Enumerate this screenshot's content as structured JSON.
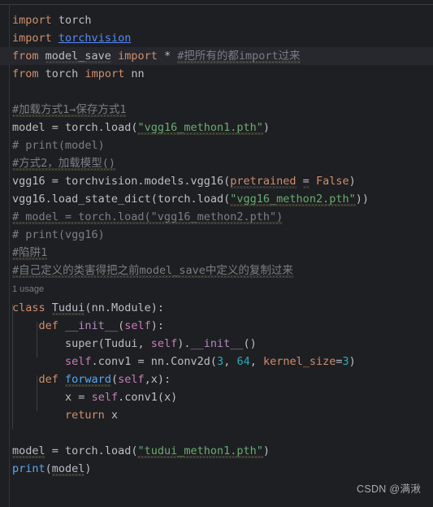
{
  "editor": {
    "theme": "darcula-dark",
    "background": "#1e1f22",
    "highlight_line_background": "#26282e",
    "default_text_color": "#bcbec4",
    "colors": {
      "keyword": "#cf8e6d",
      "string": "#6aab73",
      "number": "#2aacb8",
      "comment": "#7a7e85",
      "self_keyword": "#c77dbb",
      "function_decl": "#56a8f5",
      "dunder": "#b389c5",
      "hyperlink": "#548af7",
      "inlay_hint": "#777b82"
    },
    "inlay_hints": [
      {
        "text": "1 usage",
        "above_line": 20
      }
    ],
    "lines": [
      {
        "n": 1,
        "text": "import torch"
      },
      {
        "n": 2,
        "text": "import torchvision"
      },
      {
        "n": 3,
        "text": "from model_save import * #把所有的都import过来",
        "highlighted": true
      },
      {
        "n": 4,
        "text": "from torch import nn"
      },
      {
        "n": 5,
        "text": ""
      },
      {
        "n": 6,
        "text": "#加载方式1→保存方式1"
      },
      {
        "n": 7,
        "text": "model = torch.load(\"vgg16_methon1.pth\")"
      },
      {
        "n": 8,
        "text": "# print(model)"
      },
      {
        "n": 9,
        "text": "#方式2，加载模型()"
      },
      {
        "n": 10,
        "text": "vgg16 = torchvision.models.vgg16(pretrained = False)"
      },
      {
        "n": 11,
        "text": "vgg16.load_state_dict(torch.load(\"vgg16_methon2.pth\"))"
      },
      {
        "n": 12,
        "text": "# model = torch.load(\"vgg16_methon2.pth\")"
      },
      {
        "n": 13,
        "text": "# print(vgg16)"
      },
      {
        "n": 14,
        "text": "#陷阱1"
      },
      {
        "n": 15,
        "text": "#自己定义的类害得把之前model_save中定义的复制过来"
      },
      {
        "n": 16,
        "text": "class Tudui(nn.Module):"
      },
      {
        "n": 17,
        "text": "    def __init__(self):"
      },
      {
        "n": 18,
        "text": "        super(Tudui, self).__init__()"
      },
      {
        "n": 19,
        "text": "        self.conv1 = nn.Conv2d(3, 64, kernel_size=3)"
      },
      {
        "n": 20,
        "text": "    def forward(self,x):"
      },
      {
        "n": 21,
        "text": "        x = self.conv1(x)"
      },
      {
        "n": 22,
        "text": "        return x"
      },
      {
        "n": 23,
        "text": ""
      },
      {
        "n": 24,
        "text": ""
      },
      {
        "n": 25,
        "text": "model = torch.load(\"tudui_methon1.pth\")"
      },
      {
        "n": 26,
        "text": "print(model)"
      }
    ]
  },
  "tokens": {
    "import": "import",
    "from": "from",
    "class_kw": "class",
    "def_kw": "def",
    "return_kw": "return",
    "false_kw": "False",
    "torch": "torch",
    "torchvision": "torchvision",
    "model_save": "model_save",
    "star": "*",
    "nn": "nn",
    "comment_import_all": "#把所有的都import过来",
    "comment_load_method1": "#加载方式1→保存方式1",
    "comment_print_model": "# print(model)",
    "comment_method2": "#方式2，加载模型()",
    "comment_model_load": "# model = torch.load(\"vgg16_methon2.pth\")",
    "comment_print_vgg16": "# print(vgg16)",
    "comment_trap1": "#陷阱1",
    "comment_copy_class": "#自己定义的类害得把之前model_save中定义的复制过来",
    "str_vgg16_m1": "\"vgg16_methon1.pth\"",
    "str_vgg16_m2": "\"vgg16_methon2.pth\"",
    "str_tudui_m1": "\"tudui_methon1.pth\"",
    "pretrained": "pretrained",
    "kernel_size": "kernel_size",
    "num_3": "3",
    "num_64": "64",
    "class_name": "Tudui",
    "module": "nn.Module",
    "init": "__init__",
    "forward": "forward",
    "self": "self",
    "x": "x",
    "conv1": "conv1",
    "conv2d": "Conv2d",
    "super": "super",
    "print": "print",
    "load": "load",
    "load_state_dict": "load_state_dict",
    "models_vgg16": "torchvision.models.vgg16",
    "vgg16": "vgg16",
    "model": "model"
  },
  "watermark": {
    "text": "CSDN @满湫"
  }
}
